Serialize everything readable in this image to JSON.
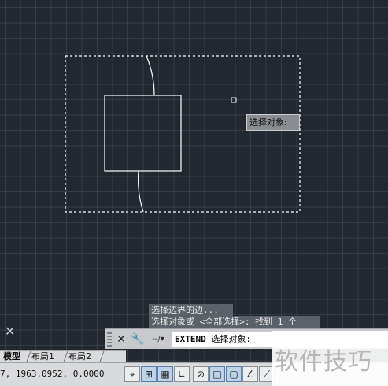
{
  "tooltip": {
    "label": "选择对象:"
  },
  "history": {
    "line1": "选择边界的边...",
    "line2": "选择对象或 <全部选择>: 找到 1 个"
  },
  "command_line": {
    "recent_icon": "--/▾",
    "command": "EXTEND",
    "prompt": "选择对象:"
  },
  "tabs": [
    {
      "label": "模型"
    },
    {
      "label": "布局1"
    },
    {
      "label": "布局2"
    }
  ],
  "status": {
    "coordinates": "7, 1963.0952, 0.0000"
  },
  "toolbar_icons": [
    "snap-mode-icon",
    "grid-display-icon",
    "ortho-mode-icon",
    "polar-tracking-icon",
    "object-snap-icon",
    "object-snap-tracking-icon",
    "dynamic-ucs-icon",
    "dynamic-input-icon"
  ],
  "colors": {
    "canvas_bg": "#212830",
    "selection_box": "#ffffff",
    "command_bar_bg": "#c7c9cc"
  },
  "watermark": {
    "text": "软件技巧"
  }
}
